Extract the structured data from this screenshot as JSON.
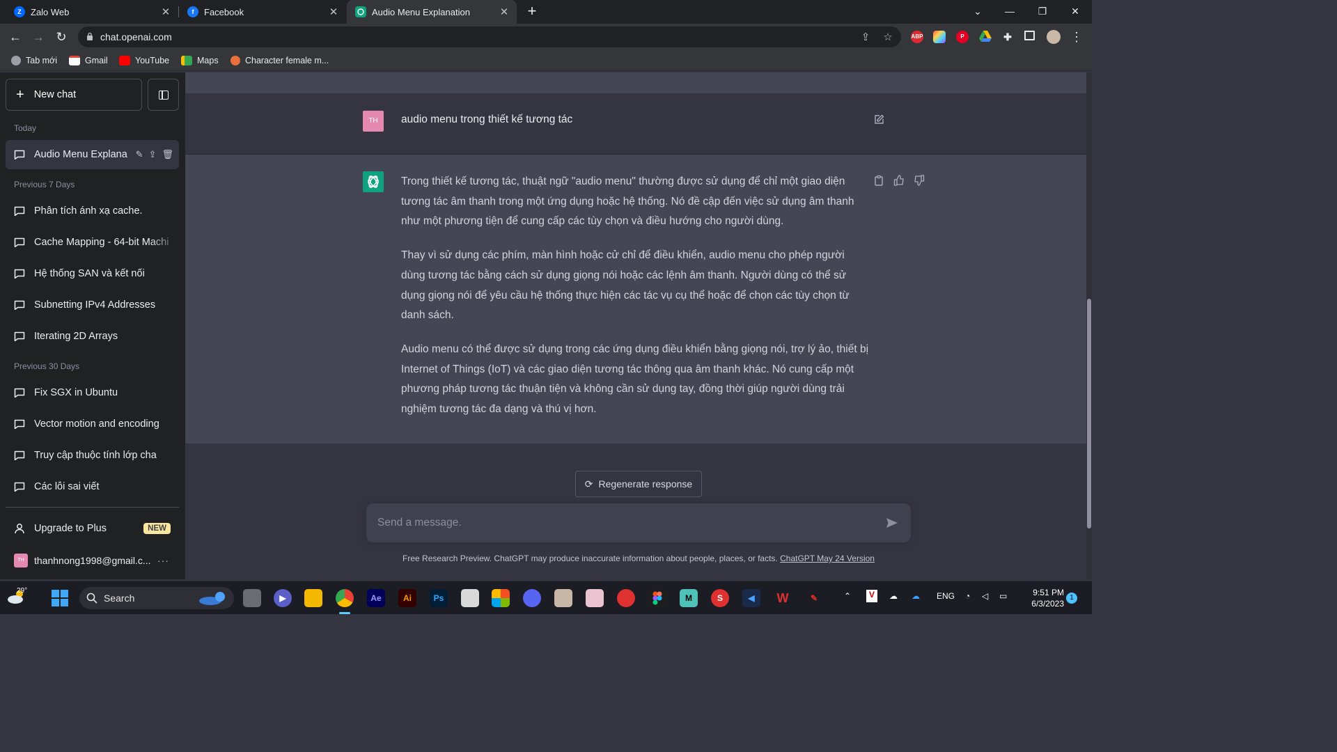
{
  "browser": {
    "tabs": [
      {
        "title": "Zalo Web",
        "favicon": "zalo-icon",
        "color": "#0068ff"
      },
      {
        "title": "Facebook",
        "favicon": "facebook-icon",
        "color": "#1877f2"
      },
      {
        "title": "Audio Menu Explanation",
        "favicon": "openai-icon",
        "color": "#10a37f"
      }
    ],
    "url": "chat.openai.com",
    "bookmarks": [
      {
        "label": "Tab mới",
        "icon": "globe-icon"
      },
      {
        "label": "Gmail",
        "icon": "gmail-icon"
      },
      {
        "label": "YouTube",
        "icon": "youtube-icon"
      },
      {
        "label": "Maps",
        "icon": "maps-icon"
      },
      {
        "label": "Character female m...",
        "icon": "character-icon"
      }
    ],
    "extensions": {
      "abp_label": "ABP"
    }
  },
  "sidebar": {
    "new_chat_label": "New chat",
    "today_label": "Today",
    "active_chat": "Audio Menu Explana",
    "prev7_label": "Previous 7 Days",
    "prev7_items": [
      "Phân tích ánh xạ cache.",
      "Cache Mapping - 64-bit Machi",
      "Hệ thống SAN và kết nối",
      "Subnetting IPv4 Addresses",
      "Iterating 2D Arrays"
    ],
    "prev30_label": "Previous 30 Days",
    "prev30_items": [
      "Fix SGX in Ubuntu",
      "Vector motion and encoding",
      "Truy cập thuộc tính lớp cha",
      "Các lỗi sai viết"
    ],
    "upgrade_label": "Upgrade to Plus",
    "new_badge": "NEW",
    "account_email": "thanhnong1998@gmail.c...",
    "avatar_initials": "TH"
  },
  "conversation": {
    "user_initials": "TH",
    "user_message": "audio menu trong thiết kế tương tác",
    "assistant_paragraphs": [
      "Trong thiết kế tương tác, thuật ngữ \"audio menu\" thường được sử dụng để chỉ một giao diện tương tác âm thanh trong một ứng dụng hoặc hệ thống. Nó đề cập đến việc sử dụng âm thanh như một phương tiện để cung cấp các tùy chọn và điều hướng cho người dùng.",
      "Thay vì sử dụng các phím, màn hình hoặc cử chỉ để điều khiển, audio menu cho phép người dùng tương tác bằng cách sử dụng giọng nói hoặc các lệnh âm thanh. Người dùng có thể sử dụng giọng nói để yêu cầu hệ thống thực hiện các tác vụ cụ thể hoặc để chọn các tùy chọn từ danh sách.",
      "Audio menu có thể được sử dụng trong các ứng dụng điều khiển bằng giọng nói, trợ lý ảo, thiết bị Internet of Things (IoT) và các giao diện tương tác thông qua âm thanh khác. Nó cung cấp một phương pháp tương tác thuận tiện và không cần sử dụng tay, đồng thời giúp người dùng trải nghiệm tương tác đa dạng và thú vị hơn."
    ],
    "regenerate_label": "Regenerate response",
    "input_placeholder": "Send a message.",
    "disclaimer_text": "Free Research Preview. ChatGPT may produce inaccurate information about people, places, or facts. ",
    "disclaimer_link": "ChatGPT May 24 Version"
  },
  "taskbar": {
    "temperature": "29°",
    "search_label": "Search",
    "language": "ENG",
    "time": "9:51 PM",
    "date": "6/3/2023",
    "notifications": "1",
    "apps": [
      {
        "name": "Ae",
        "color": "#00005b",
        "text_color": "#9999ff"
      },
      {
        "name": "Ai",
        "color": "#330000",
        "text_color": "#ff9a00"
      },
      {
        "name": "Ps",
        "color": "#001e36",
        "text_color": "#31a8ff"
      }
    ]
  },
  "colors": {
    "sidebar_bg": "#202123",
    "main_bg": "#343541",
    "assistant_bg": "#444654",
    "gpt_green": "#10a37f",
    "user_pink": "#e589b0"
  }
}
